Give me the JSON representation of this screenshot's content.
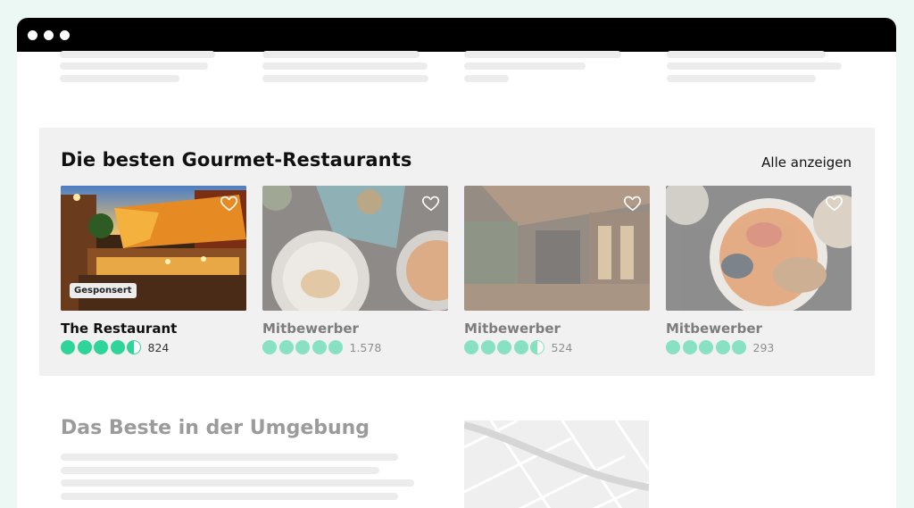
{
  "section": {
    "title": "Die besten Gourmet-Restaurants",
    "see_all": "Alle anzeigen"
  },
  "cards": [
    {
      "name": "The Restaurant",
      "rating": 4.5,
      "reviews": "824",
      "sponsored_label": "Gesponsert",
      "highlighted": true
    },
    {
      "name": "Mitbewerber",
      "rating": 5,
      "reviews": "1.578",
      "highlighted": false
    },
    {
      "name": "Mitbewerber",
      "rating": 4.5,
      "reviews": "524",
      "highlighted": false
    },
    {
      "name": "Mitbewerber",
      "rating": 5,
      "reviews": "293",
      "highlighted": false
    }
  ],
  "nearby": {
    "title": "Das Beste in der Umgebung"
  },
  "colors": {
    "rating_bubble": "#2fd49a",
    "accent_bg": "#ebf8f3",
    "titlebar": "#000000"
  },
  "icons": {
    "card_favorite": "heart-icon",
    "window_controls": "dot-icon"
  }
}
